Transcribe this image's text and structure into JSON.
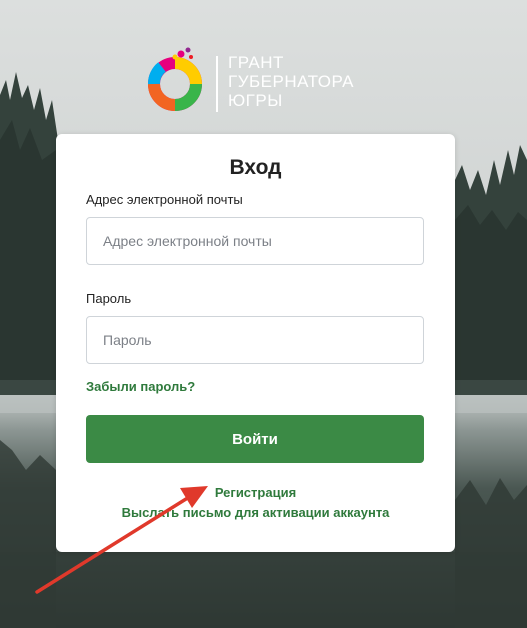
{
  "logo": {
    "line1": "ГРАНТ",
    "line2": "ГУБЕРНАТОРА",
    "line3": "ЮГРЫ"
  },
  "form": {
    "title": "Вход",
    "email_label": "Адрес электронной почты",
    "email_placeholder": "Адрес электронной почты",
    "email_value": "",
    "password_label": "Пароль",
    "password_placeholder": "Пароль",
    "password_value": "",
    "forgot_link": "Забыли пароль?",
    "login_button": "Войти",
    "register_link": "Регистрация",
    "activation_link": "Выслать письмо для активации аккаунта"
  },
  "colors": {
    "accent_green": "#3b8a45",
    "link_green": "#2f7a3c",
    "annotation_arrow": "#e0392b"
  },
  "icons": {
    "logo": "colorful-ring-logo-icon",
    "annotation": "red-arrow-icon"
  }
}
